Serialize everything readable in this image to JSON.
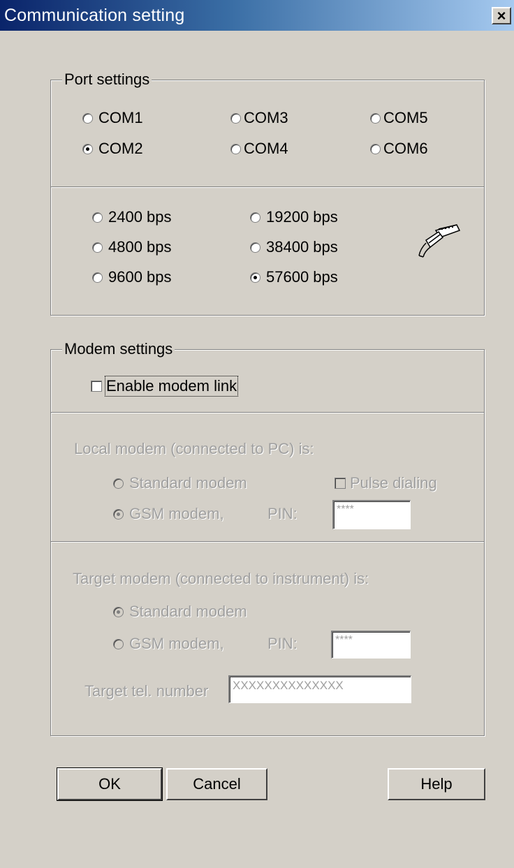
{
  "window": {
    "title": "Communication setting",
    "close_label": "×"
  },
  "port": {
    "legend": "Port settings",
    "com_ports": [
      {
        "label": "COM1",
        "checked": false
      },
      {
        "label": "COM3",
        "checked": false
      },
      {
        "label": "COM5",
        "checked": false
      },
      {
        "label": "COM2",
        "checked": true
      },
      {
        "label": "COM4",
        "checked": false
      },
      {
        "label": "COM6",
        "checked": false
      }
    ],
    "baud_rates": [
      {
        "label": "2400 bps",
        "checked": false
      },
      {
        "label": "19200 bps",
        "checked": false
      },
      {
        "label": "4800 bps",
        "checked": false
      },
      {
        "label": "38400 bps",
        "checked": false
      },
      {
        "label": "9600 bps",
        "checked": false
      },
      {
        "label": "57600 bps",
        "checked": true
      }
    ],
    "icon": "serial-plug-icon"
  },
  "modem": {
    "legend": "Modem settings",
    "enable_label": "Enable modem link",
    "enabled": false,
    "local": {
      "heading": "Local modem (connected to PC) is:",
      "standard_label": "Standard modem",
      "gsm_label": "GSM modem,",
      "pin_label": "PIN:",
      "pin_value": "****",
      "pulse_label": "Pulse dialing",
      "selected": "gsm"
    },
    "target": {
      "heading": "Target modem (connected to instrument) is:",
      "standard_label": "Standard modem",
      "gsm_label": "GSM modem,",
      "pin_label": "PIN:",
      "pin_value": "****",
      "tel_label": "Target tel. number",
      "tel_value": "XXXXXXXXXXXXXX",
      "selected": "standard"
    }
  },
  "buttons": {
    "ok": "OK",
    "cancel": "Cancel",
    "help": "Help"
  },
  "colors": {
    "face": "#d4d0c8",
    "title_start": "#0a246a",
    "title_end": "#a6caf0",
    "disabled_text": "#a0a0a0"
  }
}
